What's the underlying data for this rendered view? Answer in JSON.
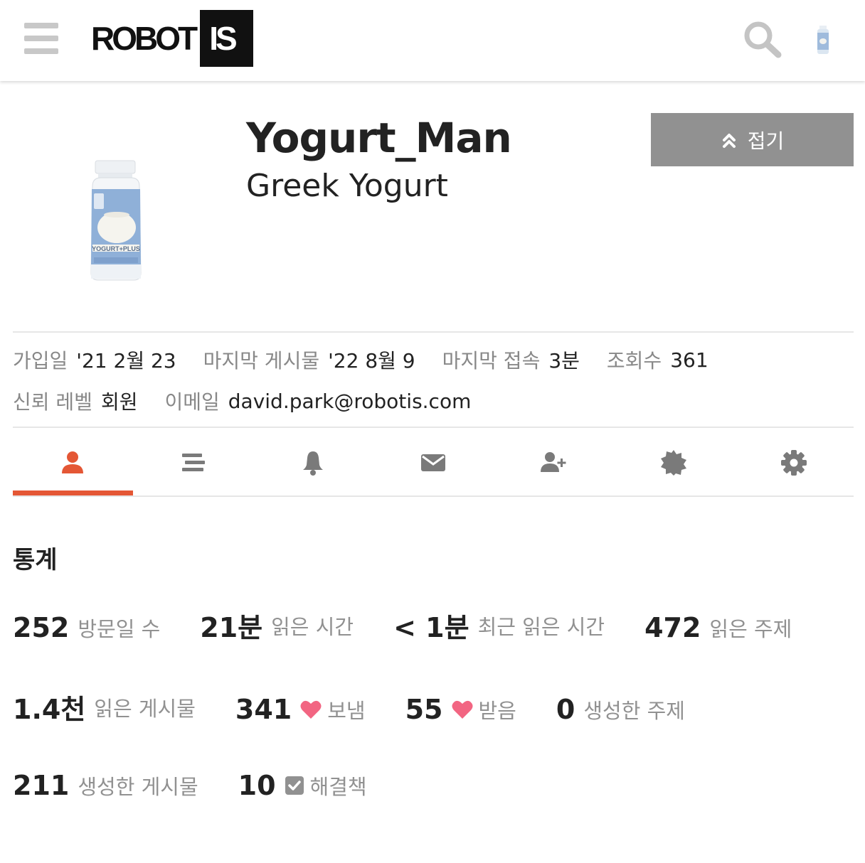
{
  "header": {
    "logo_main": "ROBOT",
    "logo_box": "IS",
    "menu_icon": "hamburger-menu-icon",
    "search_icon": "search-icon",
    "avatar_icon": "yogurt-bottle-avatar"
  },
  "profile": {
    "username": "Yogurt_Man",
    "full_name": "Greek Yogurt",
    "avatar_icon": "yogurt-bottle-image",
    "collapse_label": "접기",
    "collapse_icon": "double-chevron-up-icon"
  },
  "meta": {
    "joined_label": "가입일",
    "joined_value": "'21 2월 23",
    "last_post_label": "마지막 게시물",
    "last_post_value": "'22 8월 9",
    "last_seen_label": "마지막 접속",
    "last_seen_value": "3분",
    "views_label": "조회수",
    "views_value": "361",
    "trust_label": "신뢰 레벨",
    "trust_value": "회원",
    "email_label": "이메일",
    "email_value": "david.park@robotis.com"
  },
  "tabs": [
    {
      "icon": "user-icon",
      "active": true
    },
    {
      "icon": "stream-list-icon",
      "active": false
    },
    {
      "icon": "bell-icon",
      "active": false
    },
    {
      "icon": "envelope-icon",
      "active": false
    },
    {
      "icon": "user-plus-icon",
      "active": false
    },
    {
      "icon": "badge-certificate-icon",
      "active": false
    },
    {
      "icon": "gear-icon",
      "active": false
    }
  ],
  "stats": {
    "title": "통계",
    "items": [
      {
        "value": "252",
        "label": "방문일 수"
      },
      {
        "value": "21분",
        "label": "읽은 시간"
      },
      {
        "value": "< 1분",
        "label": "최근 읽은 시간"
      },
      {
        "value": "472",
        "label": "읽은 주제"
      },
      {
        "value": "1.4천",
        "label": "읽은 게시물"
      },
      {
        "value": "341",
        "label": "보냄",
        "icon": "heart-icon"
      },
      {
        "value": "55",
        "label": "받음",
        "icon": "heart-icon"
      },
      {
        "value": "0",
        "label": "생성한 주제"
      },
      {
        "value": "211",
        "label": "생성한 게시물"
      },
      {
        "value": "10",
        "label": "해결책",
        "icon": "check-square-icon"
      }
    ]
  },
  "colors": {
    "accent": "#e45735",
    "heart": "#f26582",
    "muted_text": "#919191",
    "button_bg": "#919191"
  }
}
